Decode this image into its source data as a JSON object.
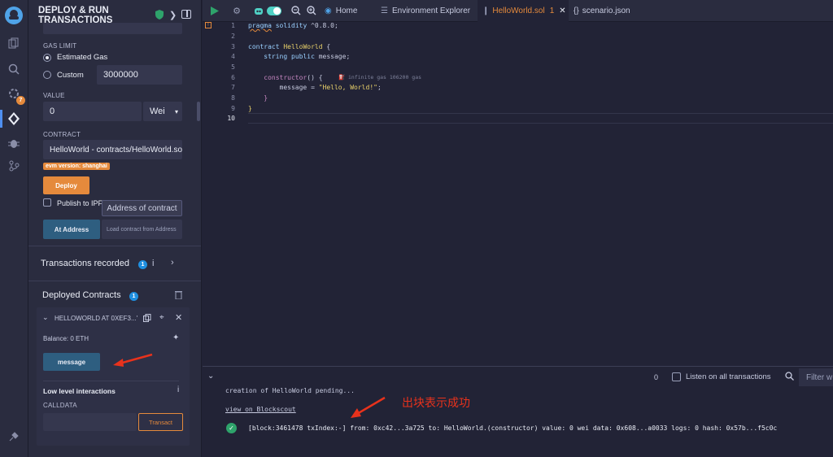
{
  "panel": {
    "title": "DEPLOY & RUN\nTRANSACTIONS",
    "gas_limit_label": "GAS LIMIT",
    "estimated_gas_label": "Estimated Gas",
    "custom_label": "Custom",
    "custom_value": "3000000",
    "value_label": "VALUE",
    "value_amount": "0",
    "value_unit": "Wei",
    "contract_label": "CONTRACT",
    "contract_selected": "HelloWorld - contracts/HelloWorld.sol",
    "evm_badge": "evm version: shanghai",
    "deploy_label": "Deploy",
    "publish_ipfs_label": "Publish to IPFS",
    "tooltip_text": "Address of contract",
    "at_address_label": "At Address",
    "load_contract_placeholder": "Load contract from Address",
    "transactions_recorded_label": "Transactions recorded",
    "transactions_recorded_count": "1",
    "deployed_contracts_label": "Deployed Contracts",
    "deployed_contracts_count": "1",
    "instance_name": "HELLOWORLD AT 0XEF3...'",
    "balance_text": "Balance: 0 ETH",
    "message_button_label": "message",
    "low_level_label": "Low level interactions",
    "calldata_label": "CALLDATA",
    "transact_label": "Transact"
  },
  "rail": {
    "notification_count": "7"
  },
  "tabs": {
    "home": "Home",
    "env_explorer": "Environment Explorer",
    "active_file": "HelloWorld.sol",
    "active_file_count": "1",
    "scenario": "scenario.json"
  },
  "editor": {
    "line_numbers": [
      "1",
      "2",
      "3",
      "4",
      "5",
      "6",
      "7",
      "8",
      "9",
      "10"
    ],
    "gas_hint": "infinite gas 106200 gas"
  },
  "terminal": {
    "tx_count": "0",
    "listen_label": "Listen on all transactions",
    "filter_placeholder": "Filter w",
    "pending_text": "creation of HelloWorld pending...",
    "blockscout_link": "view on Blockscout",
    "annotation_cn": "出块表示成功",
    "log_line": "[block:3461478 txIndex:-] from: 0xc42...3a725 to: HelloWorld.(constructor) value: 0 wei data: 0x608...a0033 logs: 0 hash: 0x57b...f5c0c"
  },
  "colors": {
    "accent_orange": "#e58a3c",
    "accent_blue": "#1f8fe0",
    "success_green": "#2ea36b",
    "annotation_red": "#e8321c"
  }
}
